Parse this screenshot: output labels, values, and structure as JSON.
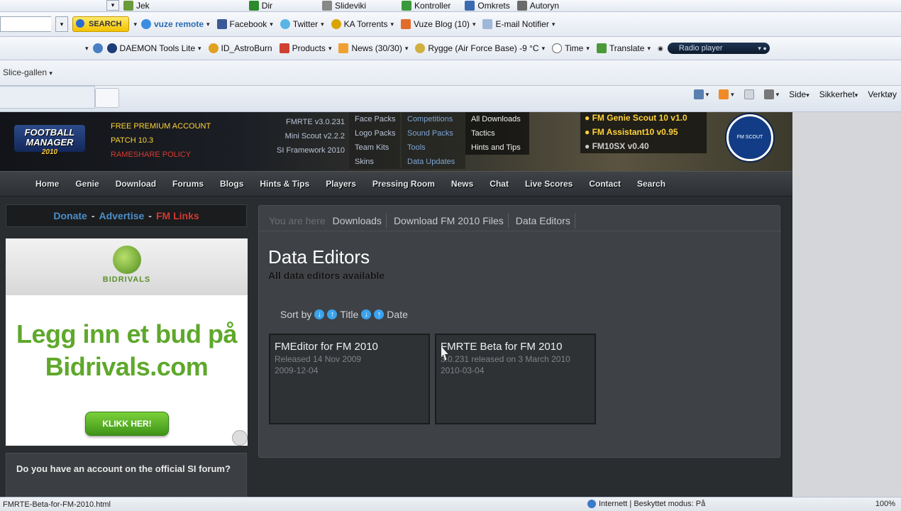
{
  "toolbar0": {
    "items": [
      "Jek",
      "Dir",
      "Slideviki",
      "Kontroller",
      "Omkrets",
      "Autoryn"
    ]
  },
  "toolbar1": {
    "search_label": "SEARCH",
    "items": [
      "vuze remote",
      "Facebook",
      "Twitter",
      "KA Torrents",
      "Vuze Blog (10)",
      "E-mail Notifier"
    ]
  },
  "toolbar2": {
    "items": [
      "DAEMON Tools Lite",
      "ID_AstroBurn",
      "Products",
      "News (30/30)",
      "Rygge (Air Force Base) -9 °C",
      "Time",
      "Translate"
    ],
    "radio": "Radio player"
  },
  "favorites": {
    "slice": "Slice-gallen"
  },
  "command_bar": {
    "side": "Side",
    "sikkerhet": "Sikkerhet",
    "verktoy": "Verktøy"
  },
  "site": {
    "logo": {
      "line1": "FOOTBALL MANAGER",
      "line2": "2010"
    },
    "promo": [
      "FREE PREMIUM ACCOUNT",
      "PATCH 10.3",
      "RAMESHARE POLICY"
    ],
    "header_col1": [
      "FMRTE v3.0.231",
      "Mini Scout v2.2.2",
      "SI Framework 2010"
    ],
    "header_col2": [
      "Face Packs",
      "Logo Packs",
      "Team Kits",
      "Skins"
    ],
    "header_col3": [
      "Competitions",
      "Sound Packs",
      "Tools",
      "Data Updates"
    ],
    "header_col4": [
      "All Downloads",
      "Tactics",
      "Hints and Tips"
    ],
    "header_col5": [
      "FM Genie Scout 10 v1.0",
      "FM Assistant10 v0.95",
      "FM10SX v0.40"
    ],
    "badge": "FM SCOUT",
    "nav": [
      "Home",
      "Genie",
      "Download",
      "Forums",
      "Blogs",
      "Hints & Tips",
      "Players",
      "Pressing Room",
      "News",
      "Chat",
      "Live Scores",
      "Contact",
      "Search"
    ],
    "donate": {
      "a": "Donate",
      "sep": "-",
      "b": "Advertise",
      "c": "FM Links"
    },
    "ad": {
      "brand": "BIDRIVALS",
      "line1": "Legg inn et bud på",
      "line2": "Bidrivals.com",
      "button": "KLIKK HER!"
    },
    "account_prompt": "Do you have an account on the official SI forum?",
    "breadcrumb": {
      "label": "You are here",
      "items": [
        "Downloads",
        "Download FM 2010 Files",
        "Data Editors"
      ]
    },
    "page_title": "Data Editors",
    "page_subtitle": "All data editors available",
    "sort": {
      "label": "Sort by",
      "title": "Title",
      "date": "Date"
    },
    "cards": [
      {
        "title": "FMEditor for FM 2010",
        "meta1": "Released 14 Nov 2009",
        "meta2": "2009-12-04"
      },
      {
        "title": "FMRTE Beta for FM 2010",
        "meta1": "3.0.231 released on 3 March 2010",
        "meta2": "2010-03-04"
      }
    ]
  },
  "status": {
    "url": "FMRTE-Beta-for-FM-2010.html",
    "zone": "Internett | Beskyttet modus: På",
    "zoom": "100%"
  }
}
